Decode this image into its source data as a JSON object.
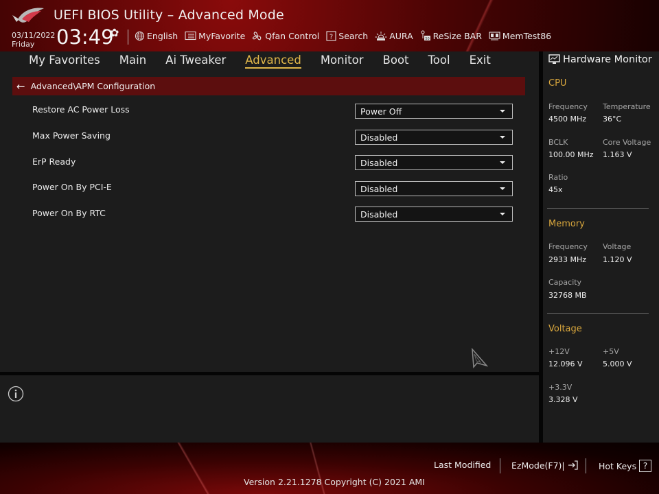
{
  "header": {
    "app_title": "UEFI BIOS Utility – Advanced Mode",
    "date": "03/11/2022",
    "day": "Friday",
    "time": "03:49",
    "toolbar": [
      {
        "label": "English",
        "icon": "globe-icon"
      },
      {
        "label": "MyFavorite",
        "icon": "favorite-list-icon"
      },
      {
        "label": "Qfan Control",
        "icon": "fan-icon"
      },
      {
        "label": "Search",
        "icon": "question-box-icon"
      },
      {
        "label": "AURA",
        "icon": "aura-light-icon"
      },
      {
        "label": "ReSize BAR",
        "icon": "resize-bar-icon"
      },
      {
        "label": "MemTest86",
        "icon": "memory-icon"
      }
    ]
  },
  "tabs": [
    {
      "label": "My Favorites",
      "active": false
    },
    {
      "label": "Main",
      "active": false
    },
    {
      "label": "Ai Tweaker",
      "active": false
    },
    {
      "label": "Advanced",
      "active": true
    },
    {
      "label": "Monitor",
      "active": false
    },
    {
      "label": "Boot",
      "active": false
    },
    {
      "label": "Tool",
      "active": false
    },
    {
      "label": "Exit",
      "active": false
    }
  ],
  "breadcrumb": "Advanced\\APM Configuration",
  "settings": [
    {
      "label": "Restore AC Power Loss",
      "value": "Power Off"
    },
    {
      "label": "Max Power Saving",
      "value": "Disabled"
    },
    {
      "label": "ErP Ready",
      "value": "Disabled"
    },
    {
      "label": "Power On By PCI-E",
      "value": "Disabled"
    },
    {
      "label": "Power On By RTC",
      "value": "Disabled"
    }
  ],
  "hardware_monitor": {
    "title": "Hardware Monitor",
    "cpu": {
      "title": "CPU",
      "frequency_label": "Frequency",
      "frequency": "4500 MHz",
      "temperature_label": "Temperature",
      "temperature": "36°C",
      "bclk_label": "BCLK",
      "bclk": "100.00 MHz",
      "core_voltage_label": "Core Voltage",
      "core_voltage": "1.163 V",
      "ratio_label": "Ratio",
      "ratio": "45x"
    },
    "memory": {
      "title": "Memory",
      "frequency_label": "Frequency",
      "frequency": "2933 MHz",
      "voltage_label": "Voltage",
      "voltage": "1.120 V",
      "capacity_label": "Capacity",
      "capacity": "32768 MB"
    },
    "voltage": {
      "title": "Voltage",
      "v12_label": "+12V",
      "v12": "12.096 V",
      "v5_label": "+5V",
      "v5": "5.000 V",
      "v33_label": "+3.3V",
      "v33": "3.328 V"
    }
  },
  "footer": {
    "last_modified": "Last Modified",
    "ezmode": "EzMode(F7)|",
    "hot_keys": "Hot Keys",
    "hot_keys_glyph": "?",
    "version": "Version 2.21.1278 Copyright (C) 2021 AMI"
  },
  "colors": {
    "accent_gold": "#e2b84a",
    "section_gold": "#d9a73d",
    "breadcrumb_red": "#5c0e0e",
    "panel_bg": "#1c1c1c"
  }
}
